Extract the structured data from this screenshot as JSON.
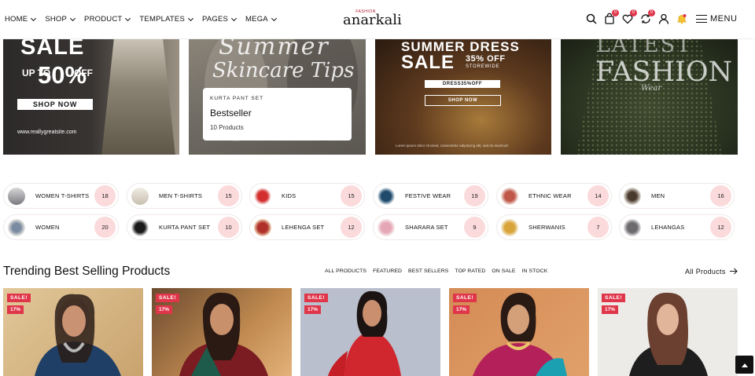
{
  "header": {
    "nav": [
      {
        "label": "HOME"
      },
      {
        "label": "SHOP"
      },
      {
        "label": "PRODUCT"
      },
      {
        "label": "TEMPLATES"
      },
      {
        "label": "PAGES"
      },
      {
        "label": "MEGA"
      }
    ],
    "logo_sup": "FASHION",
    "logo_name": "anarkali",
    "cart_count": "0",
    "wishlist_count": "0",
    "compare_count": "0",
    "menu_label": "MENU"
  },
  "banners": {
    "b1": {
      "sale": "SALE",
      "upto": "UP TO",
      "percent": "50%",
      "off": "OFF",
      "button": "SHOP NOW",
      "site": "www.reallygreatsite.com"
    },
    "b2": {
      "script1": "Summer",
      "script2": "Skincare Tips",
      "kicker": "KURTA PANT SET",
      "title": "Bestseller",
      "count": "10 Products"
    },
    "b3": {
      "line1": "SUMMER DRESS",
      "line2": "SALE",
      "percent": "35% OFF",
      "storewide": "STOREWIDE",
      "code": "DRESS35%OFF",
      "button": "SHOP NOW",
      "fine": "Lorem ipsum dolor sit amet, consectetur adipiscing elit, sed do eiusmod"
    },
    "b4": {
      "l1": "LATEST",
      "l2": "FASHION",
      "l3": "Wear"
    }
  },
  "categories": [
    {
      "label": "WOMEN T-SHIRTS",
      "count": "18"
    },
    {
      "label": "MEN T-SHIRTS",
      "count": "15"
    },
    {
      "label": "KIDS",
      "count": "15"
    },
    {
      "label": "FESTIVE WEAR",
      "count": "19"
    },
    {
      "label": "ETHNIC WEAR",
      "count": "14"
    },
    {
      "label": "MEN",
      "count": "16"
    },
    {
      "label": "WOMEN",
      "count": "20"
    },
    {
      "label": "KURTA PANT SET",
      "count": "10"
    },
    {
      "label": "LEHENGA SET",
      "count": "12"
    },
    {
      "label": "SHARARA SET",
      "count": "9"
    },
    {
      "label": "SHERWANIS",
      "count": "7"
    },
    {
      "label": "LEHANGAS",
      "count": "12"
    }
  ],
  "trending": {
    "title": "Trending Best Selling Products",
    "filters": [
      "ALL PRODUCTS",
      "FEATURED",
      "BEST SELLERS",
      "TOP RATED",
      "ON SALE",
      "IN STOCK"
    ],
    "all_link": "All Products",
    "products": [
      {
        "sale": "SALE!",
        "pct": "17%"
      },
      {
        "sale": "SALE!",
        "pct": "17%"
      },
      {
        "sale": "SALE!",
        "pct": "17%"
      },
      {
        "sale": "SALE!",
        "pct": "17%"
      },
      {
        "sale": "SALE!",
        "pct": "17%"
      }
    ]
  },
  "colors": {
    "accent": "#e0364a",
    "badge_bg": "#fbdadc"
  }
}
